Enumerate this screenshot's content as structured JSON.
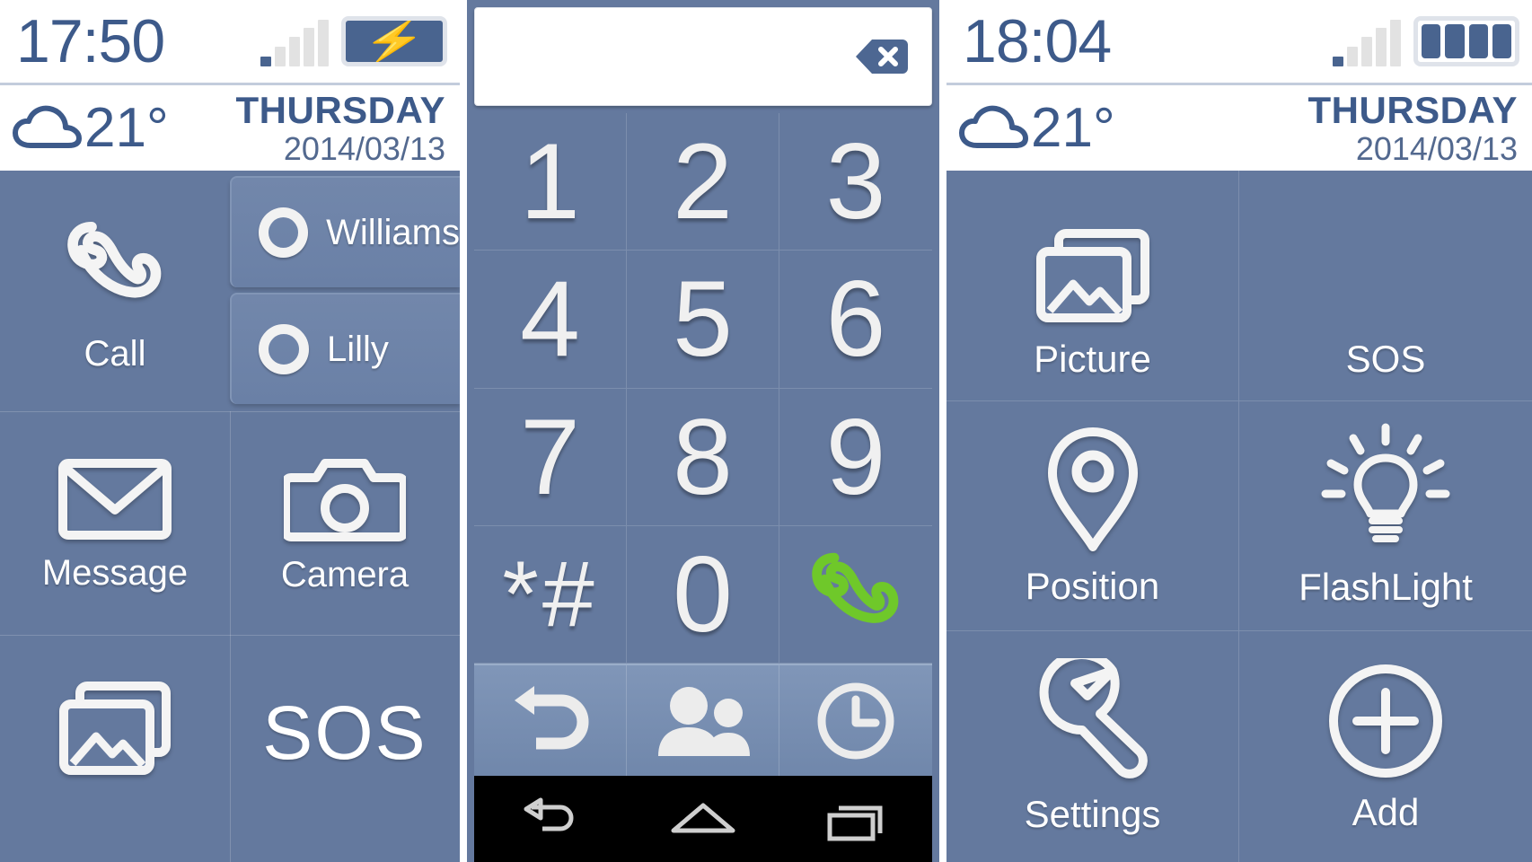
{
  "home": {
    "status": {
      "time": "17:50",
      "battery_state": "charging",
      "battery_icon": "battery-charging-icon",
      "signal_icon": "signal-bars-icon"
    },
    "weather": {
      "icon": "cloud-icon",
      "temperature": "21°",
      "day": "THURSDAY",
      "date": "2014/03/13"
    },
    "tiles": {
      "call": {
        "label": "Call",
        "icon": "phone-icon"
      },
      "message": {
        "label": "Message",
        "icon": "envelope-icon"
      },
      "camera": {
        "label": "Camera",
        "icon": "camera-icon"
      },
      "picture": {
        "label": "",
        "icon": "picture-icon"
      },
      "sos": {
        "label": "SOS",
        "icon": "sos-text-icon"
      }
    },
    "contacts": [
      {
        "name": "Williams",
        "icon": "radio-circle-icon"
      },
      {
        "name": "Lilly",
        "icon": "radio-circle-icon"
      }
    ]
  },
  "dialer": {
    "input_value": "",
    "input_placeholder": "",
    "backspace_icon": "backspace-icon",
    "keys": [
      {
        "label": "1",
        "name": "key-1"
      },
      {
        "label": "2",
        "name": "key-2"
      },
      {
        "label": "3",
        "name": "key-3"
      },
      {
        "label": "4",
        "name": "key-4"
      },
      {
        "label": "5",
        "name": "key-5"
      },
      {
        "label": "6",
        "name": "key-6"
      },
      {
        "label": "7",
        "name": "key-7"
      },
      {
        "label": "8",
        "name": "key-8"
      },
      {
        "label": "9",
        "name": "key-9"
      },
      {
        "label": "*#",
        "name": "key-star-hash"
      },
      {
        "label": "0",
        "name": "key-0"
      },
      {
        "label": "",
        "name": "key-call"
      }
    ],
    "call_key_color": "#6fc82a",
    "tools": [
      {
        "icon": "undo-arrow-icon",
        "name": "dialer-back"
      },
      {
        "icon": "contacts-people-icon",
        "name": "dialer-contacts"
      },
      {
        "icon": "clock-history-icon",
        "name": "dialer-history"
      }
    ],
    "navbar": [
      {
        "icon": "android-back-icon",
        "name": "nav-back"
      },
      {
        "icon": "android-home-icon",
        "name": "nav-home"
      },
      {
        "icon": "android-recents-icon",
        "name": "nav-recents"
      }
    ]
  },
  "tools": {
    "status": {
      "time": "18:04",
      "battery_state": "full",
      "battery_icon": "battery-full-icon",
      "signal_icon": "signal-bars-icon"
    },
    "weather": {
      "icon": "cloud-icon",
      "temperature": "21°",
      "day": "THURSDAY",
      "date": "2014/03/13"
    },
    "tiles": [
      {
        "label": "Picture",
        "icon": "picture-icon"
      },
      {
        "label": "SOS",
        "icon": "sos-text-icon"
      },
      {
        "label": "Position",
        "icon": "map-pin-icon"
      },
      {
        "label": "FlashLight",
        "icon": "lightbulb-icon"
      },
      {
        "label": "Settings",
        "icon": "wrench-icon"
      },
      {
        "label": "Add",
        "icon": "plus-circle-icon"
      }
    ]
  },
  "theme": {
    "panel_bg": "#64799e",
    "accent_blue": "#3d5a8a",
    "white": "#ffffff",
    "call_green": "#6fc82a",
    "card_bg": "#7287ab"
  }
}
